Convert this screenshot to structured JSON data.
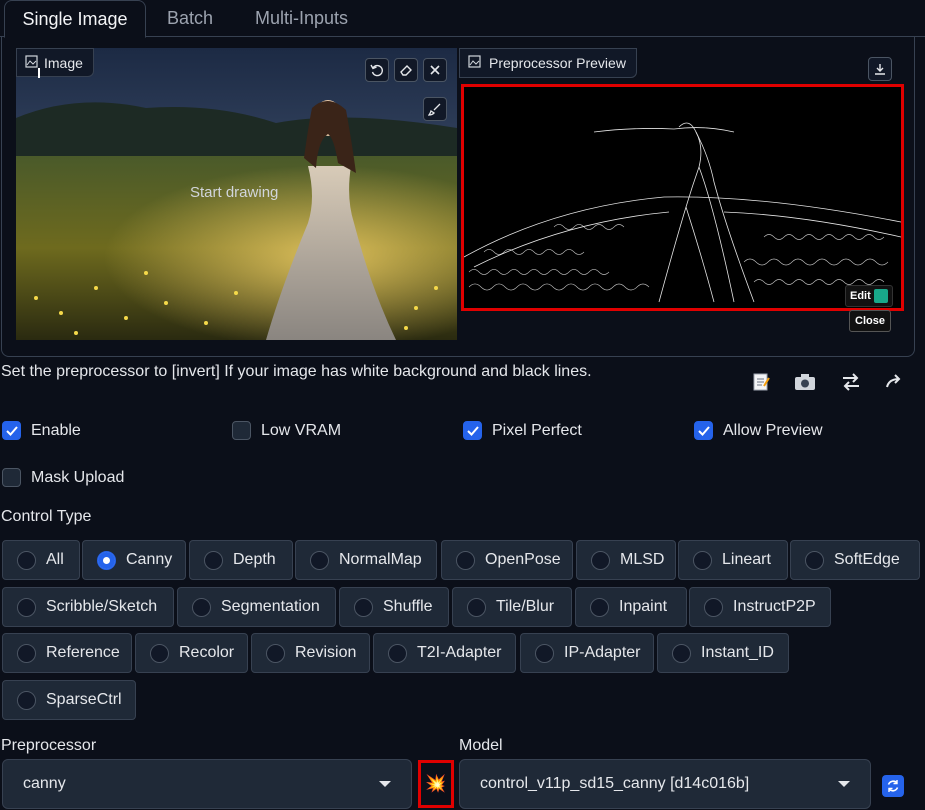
{
  "tabs": [
    {
      "label": "Single Image",
      "active": true
    },
    {
      "label": "Batch",
      "active": false
    },
    {
      "label": "Multi-Inputs",
      "active": false
    }
  ],
  "image_panel": {
    "label": "Image",
    "overlay_text": "Start drawing",
    "tool_icons": [
      "undo-icon",
      "eraser-icon",
      "close-icon",
      "brush-icon"
    ]
  },
  "preview_panel": {
    "label": "Preprocessor Preview",
    "edit_label": "Edit",
    "close_label": "Close"
  },
  "hint_text": "Set the preprocessor to [invert] If your image has white background and black lines.",
  "action_icons": [
    "notepad-icon",
    "camera-icon",
    "swap-icon",
    "send-dimensions-icon"
  ],
  "checkboxes": [
    {
      "label": "Enable",
      "checked": true
    },
    {
      "label": "Low VRAM",
      "checked": false
    },
    {
      "label": "Pixel Perfect",
      "checked": true
    },
    {
      "label": "Allow Preview",
      "checked": true
    },
    {
      "label": "Mask Upload",
      "checked": false
    }
  ],
  "control_type": {
    "label": "Control Type",
    "selected": "Canny",
    "options": [
      "All",
      "Canny",
      "Depth",
      "NormalMap",
      "OpenPose",
      "MLSD",
      "Lineart",
      "SoftEdge",
      "Scribble/Sketch",
      "Segmentation",
      "Shuffle",
      "Tile/Blur",
      "Inpaint",
      "InstructP2P",
      "Reference",
      "Recolor",
      "Revision",
      "T2I-Adapter",
      "IP-Adapter",
      "Instant_ID",
      "SparseCtrl"
    ]
  },
  "preprocessor": {
    "label": "Preprocessor",
    "value": "canny"
  },
  "model": {
    "label": "Model",
    "value": "control_v11p_sd15_canny [d14c016b]"
  },
  "colors": {
    "accent": "#2563eb",
    "highlight": "#e00000",
    "background": "#0b0f19"
  }
}
